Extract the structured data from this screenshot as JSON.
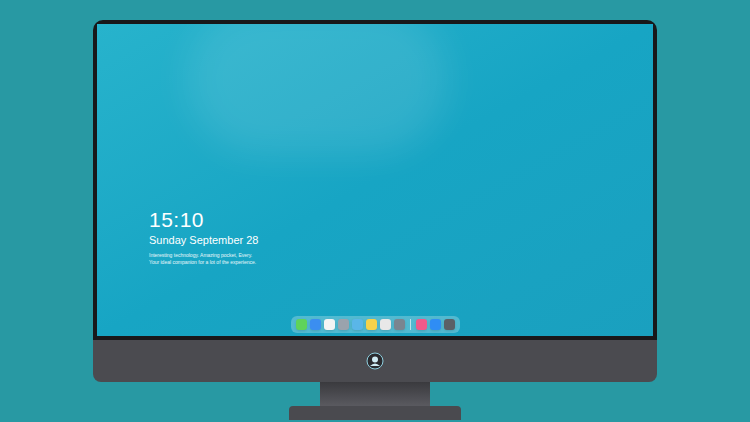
{
  "lock_screen": {
    "time": "15:10",
    "date": "Sunday September 28",
    "notes": [
      "Interesting technology. Amazing pocket, Every.",
      "Your ideal companion for a lot of the experience."
    ]
  },
  "dock": {
    "apps": [
      {
        "color": "#5fd35b"
      },
      {
        "color": "#3b8ef0"
      },
      {
        "color": "#f4f4f4"
      },
      {
        "color": "#9aa3ad"
      },
      {
        "color": "#5ab6e8"
      },
      {
        "color": "#f6d24a"
      },
      {
        "color": "#e8e8e8"
      },
      {
        "color": "#7a8590"
      },
      {
        "color": "#f05a8a"
      },
      {
        "color": "#2f8df5"
      },
      {
        "color": "#5b5f66"
      }
    ]
  }
}
